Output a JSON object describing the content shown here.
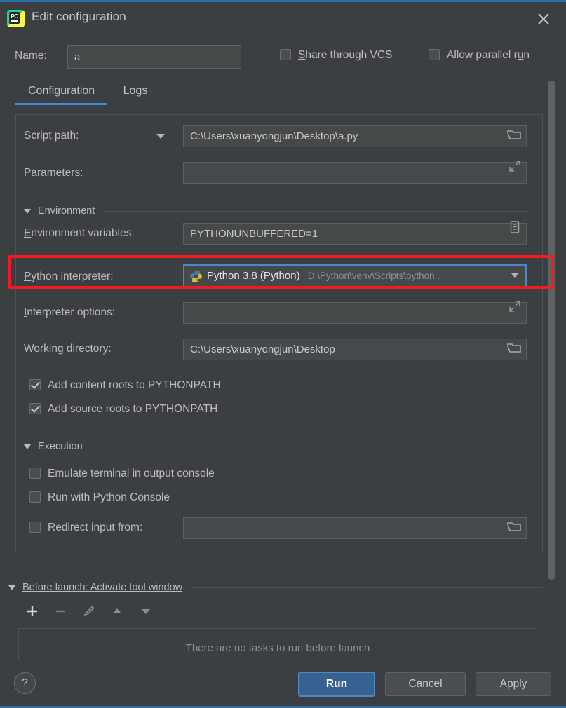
{
  "window": {
    "title": "Edit configuration",
    "logo_icon": "pycharm-logo-icon",
    "close_icon": "close-icon"
  },
  "name_row": {
    "label": "Name:",
    "label_mnemonic": "N",
    "value": "a",
    "placeholder": ""
  },
  "top_checkboxes": [
    {
      "label": "Share through VCS",
      "checked": false
    },
    {
      "label": "Allow parallel run",
      "checked": false
    }
  ],
  "tabs": [
    {
      "label": "Configuration",
      "active": true
    },
    {
      "label": "Logs",
      "active": false
    }
  ],
  "fields": {
    "script_path": {
      "label": "Script path:",
      "value": "C:\\Users\\xuanyongjun\\Desktop\\a.py",
      "dropdown_icon": "chevron-down-icon",
      "browse_icon": "folder-icon"
    },
    "parameters": {
      "label": "Parameters:",
      "label_mnemonic": "P",
      "value": "",
      "expand_icon": "expand-icon"
    },
    "environment_variables": {
      "label": "Environment variables:",
      "label_mnemonic": "E",
      "value": "PYTHONUNBUFFERED=1",
      "browse_icon": "list-edit-icon"
    },
    "python_interpreter": {
      "label": "Python interpreter:",
      "label_mnemonic": "P",
      "value": "Python 3.8 (Python)",
      "value_path": "D:\\Python\\venv\\Scripts\\python..",
      "icon": "python-icon",
      "dropdown_icon": "chevron-down-icon",
      "highlighted": true,
      "highlight_color": "#f41a21"
    },
    "interpreter_options": {
      "label": "Interpreter options:",
      "label_mnemonic": "I",
      "value": "",
      "expand_icon": "expand-icon"
    },
    "working_directory": {
      "label": "Working directory:",
      "label_mnemonic": "W",
      "value": "C:\\Users\\xuanyongjun\\Desktop",
      "browse_icon": "folder-icon"
    }
  },
  "sections": {
    "environment": {
      "title": "Environment",
      "expanded": true,
      "collapse_icon": "triangle-down-icon"
    },
    "execution": {
      "title": "Execution",
      "expanded": true,
      "collapse_icon": "triangle-down-icon"
    }
  },
  "path_checkboxes": [
    {
      "label": "Add content roots to PYTHONPATH",
      "checked": true
    },
    {
      "label": "Add source roots to PYTHONPATH",
      "checked": true
    }
  ],
  "execution_checkboxes": [
    {
      "label": "Emulate terminal in output console",
      "checked": false
    },
    {
      "label": "Run with Python Console",
      "checked": false
    },
    {
      "label": "Redirect input from:",
      "checked": false
    }
  ],
  "redirect_field": {
    "value": "",
    "browse_icon": "folder-icon"
  },
  "before_launch": {
    "title": "Before launch: Activate tool window",
    "collapse_icon": "triangle-down-icon",
    "empty_text": "There are no tasks to run before launch",
    "toolbar": [
      {
        "name": "add-button",
        "glyph": "+",
        "enabled": true
      },
      {
        "name": "remove-button",
        "glyph": "−",
        "enabled": false
      },
      {
        "name": "edit-button",
        "glyph": "pencil-icon",
        "enabled": false
      },
      {
        "name": "move-up-button",
        "glyph": "triangle-up-icon",
        "enabled": false
      },
      {
        "name": "move-down-button",
        "glyph": "triangle-down-icon",
        "enabled": false
      }
    ]
  },
  "footer": {
    "help_label": "?",
    "run_label": "Run",
    "cancel_label": "Cancel",
    "apply_label": "Apply",
    "apply_mnemonic": "A",
    "primary_color": "#37618f"
  }
}
